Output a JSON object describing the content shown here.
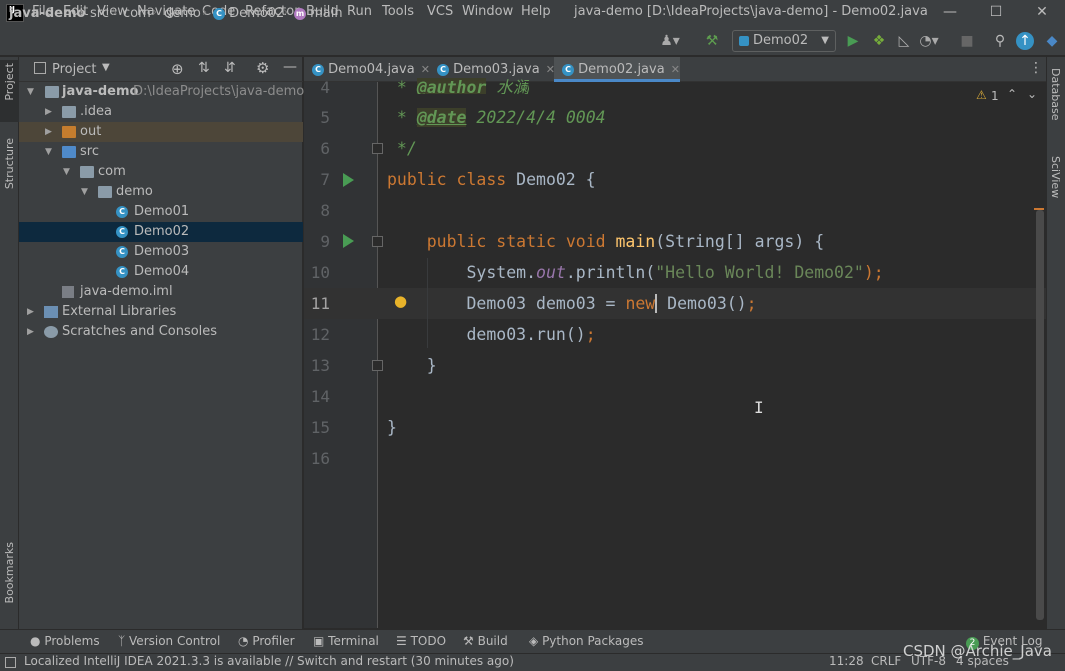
{
  "menu": [
    "File",
    "Edit",
    "View",
    "Navigate",
    "Code",
    "Refactor",
    "Build",
    "Run",
    "Tools",
    "VCS",
    "Window",
    "Help"
  ],
  "window_title": "java-demo [D:\\IdeaProjects\\java-demo] - Demo02.java",
  "logo_text": "IJ",
  "breadcrumb": {
    "project": "java-demo",
    "src": "src",
    "com": "com",
    "demo": "demo",
    "class": "Demo02",
    "method": "main",
    "class_badge": "C",
    "method_badge": "m"
  },
  "run_config": "Demo02",
  "left_strip": {
    "project": "Project",
    "structure": "Structure",
    "bookmarks": "Bookmarks"
  },
  "right_strip": {
    "database": "Database",
    "sciview": "SciView"
  },
  "project_panel": {
    "title": "Project",
    "tree": [
      {
        "label": "java-demo",
        "hint": "D:\\IdeaProjects\\java-demo"
      },
      {
        "label": ".idea"
      },
      {
        "label": "out"
      },
      {
        "label": "src"
      },
      {
        "label": "com"
      },
      {
        "label": "demo"
      },
      {
        "label": "Demo01"
      },
      {
        "label": "Demo02"
      },
      {
        "label": "Demo03"
      },
      {
        "label": "Demo04"
      },
      {
        "label": "java-demo.iml"
      },
      {
        "label": "External Libraries"
      },
      {
        "label": "Scratches and Consoles"
      }
    ]
  },
  "tabs": [
    {
      "label": "Demo04.java"
    },
    {
      "label": "Demo03.java"
    },
    {
      "label": "Demo02.java",
      "active": true
    }
  ],
  "inspection": {
    "warnings": "1"
  },
  "code_lines": {
    "n4": "4",
    "n5": "5",
    "n6": "6",
    "n7": "7",
    "n8": "8",
    "n9": "9",
    "n10": "10",
    "n11": "11",
    "n12": "12",
    "n13": "13",
    "n14": "14",
    "n15": "15",
    "n16": "16",
    "l4_star": " * ",
    "l4_tag": "@author",
    "l4_text": " 水澜",
    "l5_star": " * ",
    "l5_tag": "@date",
    "l5_text": " 2022/4/4 0004",
    "l6": " */",
    "l7_kw": "public class ",
    "l7_rest": "Demo02 {",
    "l9_indent": "    ",
    "l9_kw": "public static void ",
    "l9_fn": "main",
    "l9_rest": "(String[] args) {",
    "l10_indent": "        ",
    "l10_a": "System.",
    "l10_it": "out",
    "l10_b": ".println(",
    "l10_str": "\"Hello World! Demo02\"",
    "l10_end": ");",
    "l11_indent": "        ",
    "l11_a": "Demo03 demo03 = ",
    "l11_kw": "new",
    "l11_b": " Demo03()",
    "l11_end": ";",
    "l12_indent": "        ",
    "l12_a": "demo03.run()",
    "l12_end": ";",
    "l13": "    }",
    "l15": "}"
  },
  "bottom_tools": [
    "Problems",
    "Version Control",
    "Profiler",
    "Terminal",
    "TODO",
    "Build",
    "Python Packages"
  ],
  "event_log": {
    "label": "Event Log",
    "count": "2"
  },
  "status": {
    "message": "Localized IntelliJ IDEA 2021.3.3 is available // Switch and restart (30 minutes ago)",
    "position": "11:28",
    "line_sep": "CRLF",
    "encoding": "UTF-8",
    "indent": "4 spaces"
  },
  "watermark": "CSDN @Archie_Java",
  "colors": {
    "accent": "#4a88c7",
    "keyword": "#cc7832",
    "string": "#6a8759",
    "run": "#499c54"
  }
}
